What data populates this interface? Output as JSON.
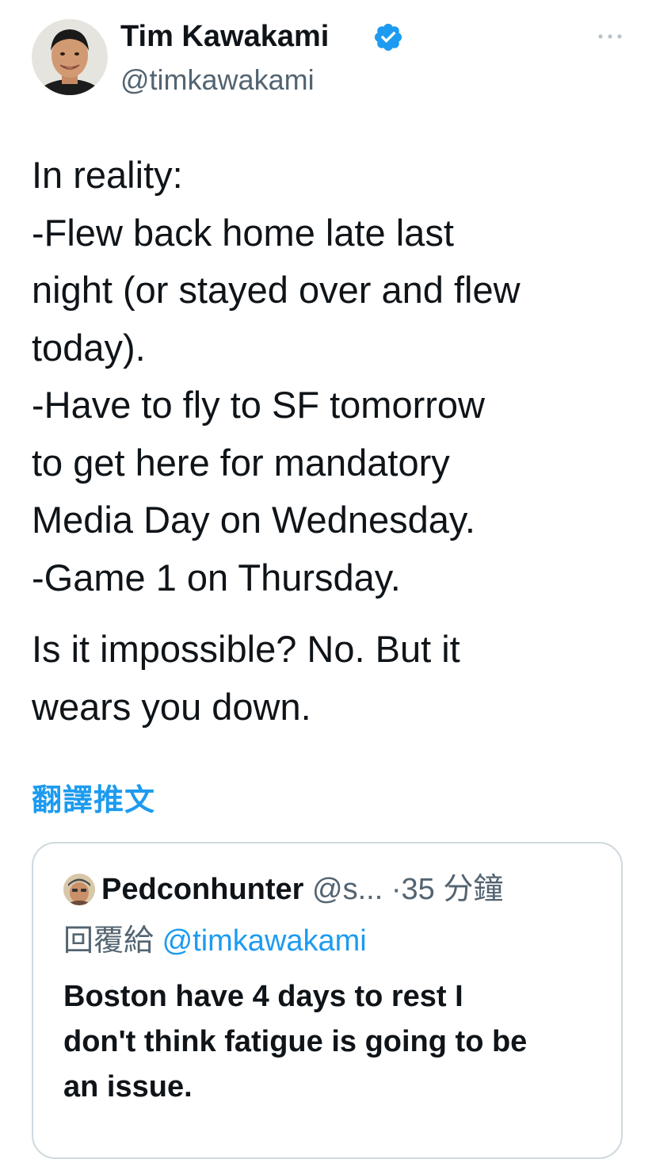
{
  "author": {
    "name": "Tim Kawakami",
    "handle": "@timkawakami",
    "verified": true,
    "avatar_icon": "person-avatar-photo"
  },
  "tweet": {
    "paragraph1": [
      "In reality:",
      "-Flew back home late last",
      "night (or stayed over and flew",
      "today).",
      "-Have to fly to SF tomorrow",
      "to get here for mandatory",
      "Media Day on Wednesday.",
      "-Game 1 on Thursday."
    ],
    "paragraph2": [
      "Is it impossible? No. But it",
      "wears you down."
    ],
    "translate_label": "翻譯推文"
  },
  "quote": {
    "author_name": "Pedconhunter",
    "handle_truncated": "@s...",
    "separator": "·",
    "time": "35 分鐘",
    "reply_prefix": "回覆給",
    "reply_mention": "@timkawakami",
    "text": [
      "Boston have 4 days to rest I",
      "don't think fatigue is going to be",
      "an issue."
    ]
  },
  "colors": {
    "accent": "#1d9bf0",
    "secondary_text": "#536471",
    "border": "#cfd9de"
  },
  "icons": {
    "verified": "verified-badge-icon",
    "more": "more-dots-icon"
  }
}
